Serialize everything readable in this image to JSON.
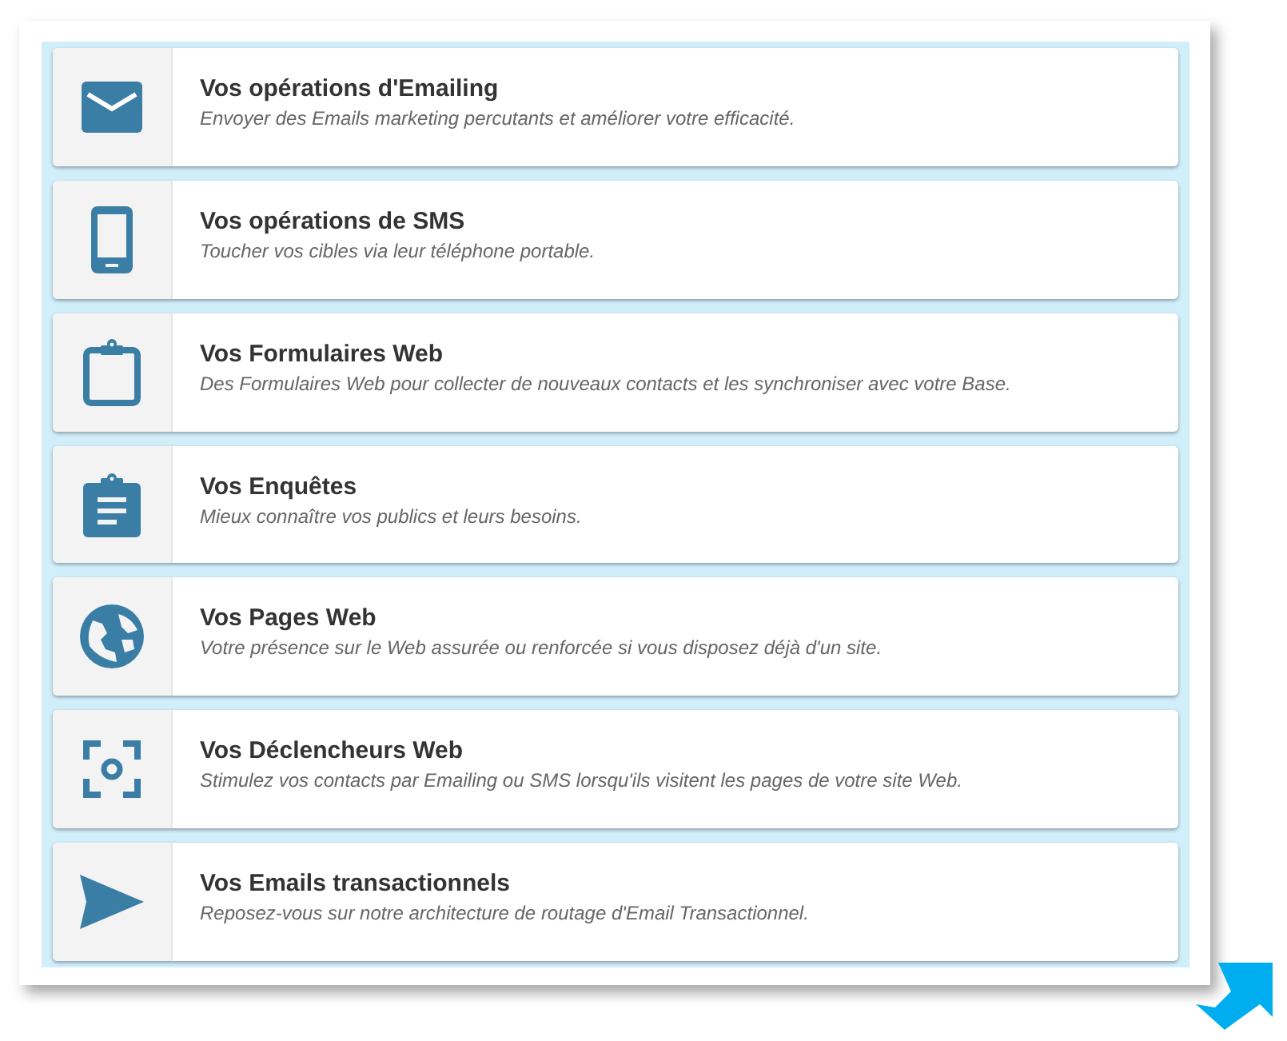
{
  "services": [
    {
      "kind": "email",
      "title": "Vos opérations d'Emailing",
      "description": "Envoyer des Emails marketing percutants et améliorer votre efficacité."
    },
    {
      "kind": "sms",
      "title": "Vos opérations de SMS",
      "description": "Toucher vos cibles via leur téléphone portable."
    },
    {
      "kind": "form",
      "title": "Vos Formulaires Web",
      "description": "Des Formulaires Web pour collecter de nouveaux contacts et les synchroniser avec votre Base."
    },
    {
      "kind": "survey",
      "title": "Vos Enquêtes",
      "description": "Mieux connaître vos publics et leurs besoins."
    },
    {
      "kind": "page",
      "title": "Vos Pages Web",
      "description": "Votre présence sur le Web assurée ou renforcée si vous disposez déjà d'un site."
    },
    {
      "kind": "trigger",
      "title": "Vos Déclencheurs Web",
      "description": "Stimulez vos contacts par Emailing ou SMS lorsqu'ils visitent les pages de votre site Web."
    },
    {
      "kind": "transactional",
      "title": "Vos Emails transactionnels",
      "description": "Reposez-vous sur notre architecture de routage d'Email Transactionnel."
    }
  ]
}
